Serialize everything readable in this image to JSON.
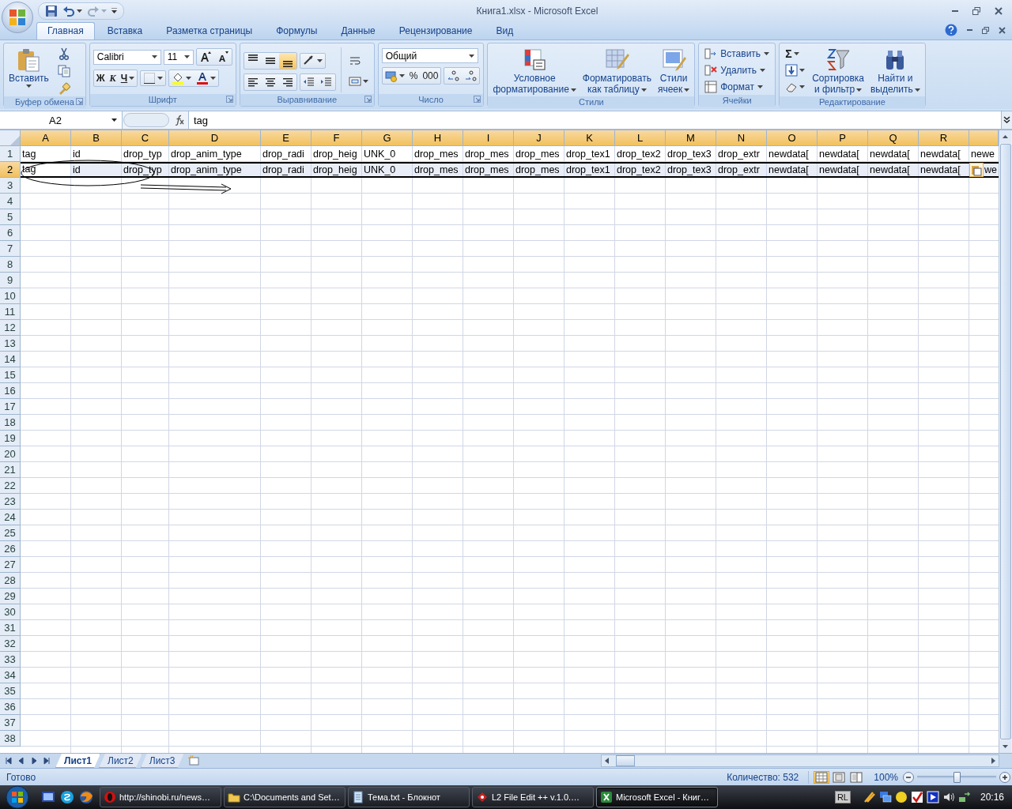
{
  "window": {
    "title": "Книга1.xlsx - Microsoft Excel"
  },
  "ribbon": {
    "tabs": [
      {
        "label": "Главная",
        "selected": true
      },
      {
        "label": "Вставка",
        "selected": false
      },
      {
        "label": "Разметка страницы",
        "selected": false
      },
      {
        "label": "Формулы",
        "selected": false
      },
      {
        "label": "Данные",
        "selected": false
      },
      {
        "label": "Рецензирование",
        "selected": false
      },
      {
        "label": "Вид",
        "selected": false
      }
    ],
    "groups": [
      {
        "kind": "clipboard",
        "label": "Буфер обмена",
        "paste": "Вставить"
      },
      {
        "kind": "font",
        "label": "Шрифт",
        "font_name": "Calibri",
        "font_size": "11",
        "bold": "Ж",
        "italic": "К",
        "underline": "Ч"
      },
      {
        "kind": "alignment",
        "label": "Выравнивание",
        "vertical": [
          {
            "selected": false
          },
          {
            "selected": false
          },
          {
            "selected": true
          }
        ]
      },
      {
        "kind": "number",
        "label": "Число",
        "format": "Общий",
        "percent": "%",
        "thousands": "000"
      },
      {
        "kind": "styles",
        "label": "Стили",
        "buttons": [
          [
            "Условное",
            "форматирование"
          ],
          [
            "Форматировать",
            "как таблицу"
          ],
          [
            "Стили",
            "ячеек"
          ]
        ]
      },
      {
        "kind": "cells",
        "label": "Ячейки",
        "buttons": [
          "Вставить",
          "Удалить",
          "Формат"
        ]
      },
      {
        "kind": "editing",
        "label": "Редактирование",
        "sum": "Σ",
        "buttons": [
          [
            "Сортировка",
            "и фильтр"
          ],
          [
            "Найти и",
            "выделить"
          ]
        ]
      }
    ]
  },
  "formula_bar": {
    "name_box": "A2",
    "value": "tag"
  },
  "sheet": {
    "columns": [
      {
        "label": "A",
        "selected": true
      },
      {
        "label": "B",
        "selected": true
      },
      {
        "label": "C",
        "selected": true
      },
      {
        "label": "D",
        "selected": true
      },
      {
        "label": "E",
        "selected": true
      },
      {
        "label": "F",
        "selected": true
      },
      {
        "label": "G",
        "selected": true
      },
      {
        "label": "H",
        "selected": true
      },
      {
        "label": "I",
        "selected": true
      },
      {
        "label": "J",
        "selected": true
      },
      {
        "label": "K",
        "selected": true
      },
      {
        "label": "L",
        "selected": true
      },
      {
        "label": "M",
        "selected": true
      },
      {
        "label": "N",
        "selected": true
      },
      {
        "label": "O",
        "selected": true
      },
      {
        "label": "P",
        "selected": true
      },
      {
        "label": "Q",
        "selected": true
      },
      {
        "label": "R",
        "selected": true
      },
      {
        "selected": true
      }
    ],
    "rows": [
      {
        "number": "1",
        "selected": false,
        "cells": [
          "tag",
          "id",
          "drop_typ",
          "drop_anim_type",
          "drop_radi",
          "drop_heig",
          "UNK_0",
          "drop_mes",
          "drop_mes",
          "drop_mes",
          "drop_tex1",
          "drop_tex2",
          "drop_tex3",
          "drop_extr",
          "newdata[",
          "newdata[",
          "newdata[",
          "newdata[",
          "newe"
        ]
      },
      {
        "number": "2",
        "selected": true,
        "active_first": true,
        "paste_options": true,
        "cells": [
          "tag",
          "id",
          "drop_typ",
          "drop_anim_type",
          "drop_radi",
          "drop_heig",
          "UNK_0",
          "drop_mes",
          "drop_mes",
          "drop_mes",
          "drop_tex1",
          "drop_tex2",
          "drop_tex3",
          "drop_extr",
          "newdata[",
          "newdata[",
          "newdata[",
          "newdata[",
          "we"
        ]
      },
      {
        "number": "3",
        "selected": false
      },
      {
        "number": "4",
        "selected": false
      },
      {
        "number": "5",
        "selected": false
      },
      {
        "number": "6",
        "selected": false
      },
      {
        "number": "7",
        "selected": false
      },
      {
        "number": "8",
        "selected": false
      },
      {
        "number": "9",
        "selected": false
      },
      {
        "number": "10",
        "selected": false
      },
      {
        "number": "11",
        "selected": false
      },
      {
        "number": "12",
        "selected": false
      },
      {
        "number": "13",
        "selected": false
      },
      {
        "number": "14",
        "selected": false
      },
      {
        "number": "15",
        "selected": false
      },
      {
        "number": "16",
        "selected": false
      },
      {
        "number": "17",
        "selected": false
      },
      {
        "number": "18",
        "selected": false
      },
      {
        "number": "19",
        "selected": false
      },
      {
        "number": "20",
        "selected": false
      },
      {
        "number": "21",
        "selected": false
      },
      {
        "number": "22",
        "selected": false
      },
      {
        "number": "23",
        "selected": false
      },
      {
        "number": "24",
        "selected": false
      },
      {
        "number": "25",
        "selected": false
      },
      {
        "number": "26",
        "selected": false
      },
      {
        "number": "27",
        "selected": false
      },
      {
        "number": "28",
        "selected": false
      },
      {
        "number": "29",
        "selected": false
      },
      {
        "number": "30",
        "selected": false
      },
      {
        "number": "31",
        "selected": false
      },
      {
        "number": "32",
        "selected": false
      },
      {
        "number": "33",
        "selected": false
      },
      {
        "number": "34",
        "selected": false
      },
      {
        "number": "35",
        "selected": false
      },
      {
        "number": "36",
        "selected": false
      },
      {
        "number": "37",
        "selected": false
      },
      {
        "number": "38",
        "selected": false
      }
    ]
  },
  "sheet_tabs": [
    {
      "label": "Лист1",
      "selected": true
    },
    {
      "label": "Лист2",
      "selected": false
    },
    {
      "label": "Лист3",
      "selected": false
    }
  ],
  "status_bar": {
    "status": "Готово",
    "count": "Количество: 532",
    "views": [
      {
        "selected": true
      },
      {
        "selected": false
      },
      {
        "selected": false
      }
    ],
    "zoom": "100%",
    "zoom_slider": {
      "level": 0.5
    }
  },
  "taskbar": {
    "buttons": [
      {
        "kind": "browser",
        "label": "http://shinobi.ru/news…",
        "selected": false
      },
      {
        "kind": "folder",
        "label": "C:\\Documents and Set…",
        "selected": false
      },
      {
        "kind": "notepad",
        "label": "Тема.txt - Блокнот",
        "selected": false
      },
      {
        "kind": "app",
        "label": "L2 File Edit ++ v.1.0.…",
        "selected": false
      },
      {
        "kind": "excel",
        "label": "Microsoft Excel - Книг…",
        "selected": true
      }
    ],
    "language": "RL",
    "clock": "20:16"
  }
}
